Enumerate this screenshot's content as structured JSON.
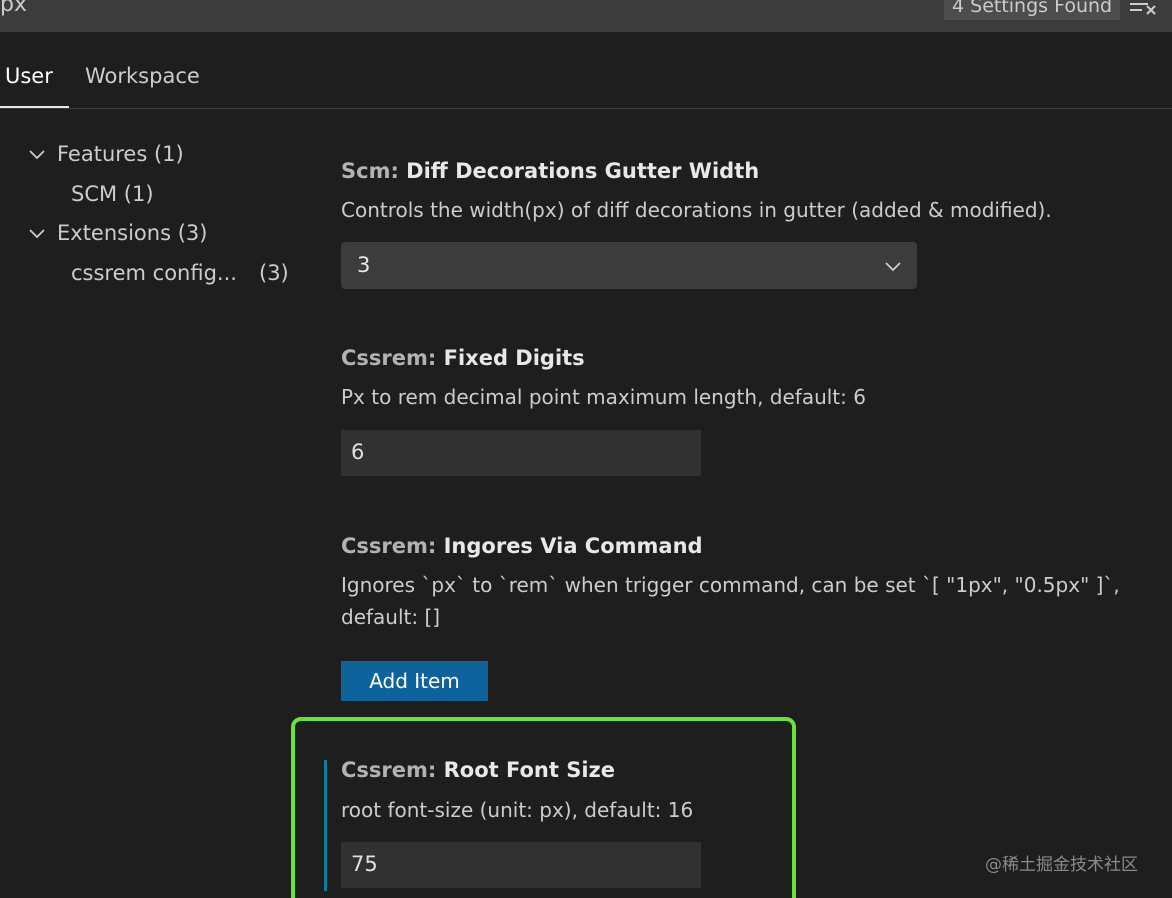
{
  "search": {
    "query": "px",
    "results_count": "4 Settings Found",
    "clear_icon": "clear-filter-icon"
  },
  "tabs": [
    {
      "label": "User",
      "active": true
    },
    {
      "label": "Workspace",
      "active": false
    }
  ],
  "toc": {
    "features": "Features (1)",
    "scm": "SCM (1)",
    "extensions": "Extensions (3)",
    "cssrem_label": "cssrem config...",
    "cssrem_count": "(3)"
  },
  "settings": [
    {
      "category": "Scm: ",
      "name": "Diff Decorations Gutter Width",
      "description": "Controls the width(px) of diff decorations in gutter (added & modified).",
      "value": "3",
      "control": "dropdown"
    },
    {
      "category": "Cssrem: ",
      "name": "Fixed Digits",
      "description": "Px to rem decimal point maximum length, default: 6",
      "value": "6",
      "control": "text-input"
    },
    {
      "category": "Cssrem: ",
      "name": "Ingores Via Command",
      "description_line1": "Ignores `px` to `rem` when trigger command, can be set `[ \"1px\", \"0.5px\" ]`,",
      "description_line2": "default: []",
      "button_label": "Add Item",
      "control": "list"
    },
    {
      "category": "Cssrem: ",
      "name": "Root Font Size",
      "description": "root font-size (unit: px), default: 16",
      "value": "75",
      "control": "text-input",
      "modified": true
    }
  ],
  "watermark": "@稀土掘金技术社区",
  "colors": {
    "background": "#1e1e1e",
    "highlight_border": "#6be03b",
    "button_bg": "#0e639c",
    "modified_indicator": "#0c7d9d"
  }
}
